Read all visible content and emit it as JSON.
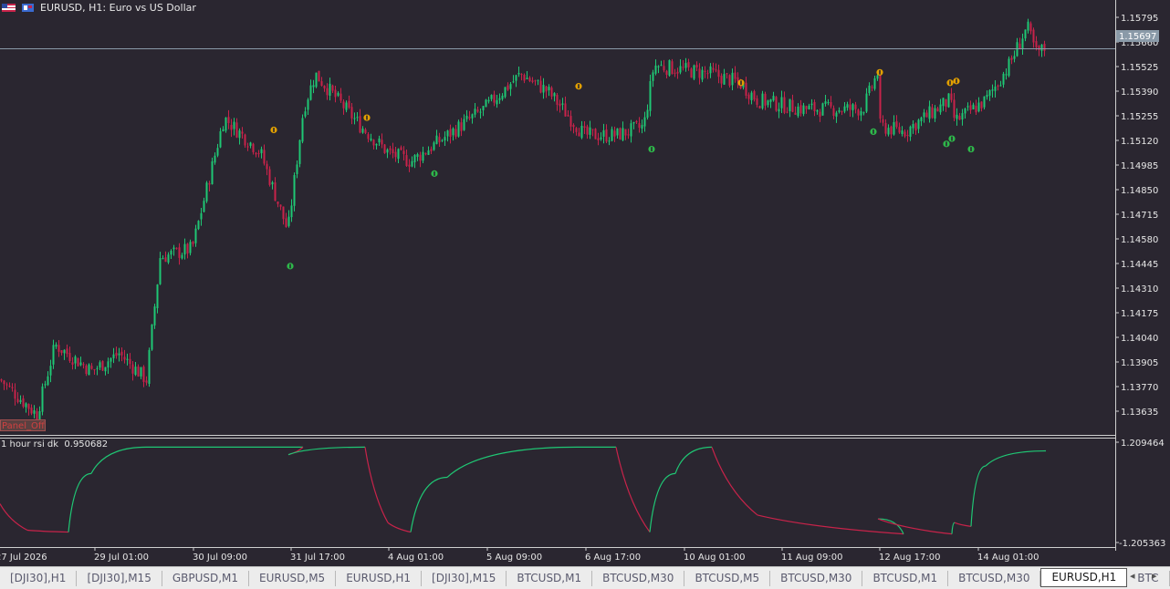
{
  "header": {
    "title": "EURUSD, H1:  Euro vs US Dollar"
  },
  "colors": {
    "background": "#2a2630",
    "bull": "#1fc774",
    "bear": "#c8234a",
    "signal_up": "#e2a000",
    "signal_down": "#2eb84a",
    "grid_line": "#cfcfcf",
    "price_line": "#8a9aa8"
  },
  "price_axis": {
    "labels": [
      "1.15795",
      "1.15660",
      "1.15525",
      "1.15390",
      "1.15255",
      "1.15120",
      "1.14985",
      "1.14850",
      "1.14715",
      "1.14580",
      "1.14445",
      "1.14310",
      "1.14175",
      "1.14040",
      "1.13905",
      "1.13770",
      "1.13635"
    ],
    "current_price": "1.15697"
  },
  "indicator": {
    "label": "1 hour rsi dk",
    "value": "0.950682",
    "axis_top": "1.209464",
    "axis_bottom": "-1.205363"
  },
  "time_axis": {
    "labels": [
      "27 Jul 2026",
      "29 Jul 01:00",
      "30 Jul 09:00",
      "31 Jul 17:00",
      "4 Aug 01:00",
      "5 Aug 09:00",
      "6 Aug 17:00",
      "10 Aug 01:00",
      "11 Aug 09:00",
      "12 Aug 17:00",
      "14 Aug 01:00"
    ]
  },
  "panel_button": {
    "label": "Panel_Off"
  },
  "tabs": [
    {
      "label": "[DJI30],H1",
      "active": false
    },
    {
      "label": "[DJI30],M15",
      "active": false
    },
    {
      "label": "GBPUSD,M1",
      "active": false
    },
    {
      "label": "EURUSD,M5",
      "active": false
    },
    {
      "label": "EURUSD,H1",
      "active": false
    },
    {
      "label": "[DJI30],M15",
      "active": false
    },
    {
      "label": "BTCUSD,M1",
      "active": false
    },
    {
      "label": "BTCUSD,M30",
      "active": false
    },
    {
      "label": "BTCUSD,M5",
      "active": false
    },
    {
      "label": "BTCUSD,M30",
      "active": false
    },
    {
      "label": "BTCUSD,M1",
      "active": false
    },
    {
      "label": "BTCUSD,M30",
      "active": false
    },
    {
      "label": "EURUSD,H1",
      "active": true
    },
    {
      "label": "BTC",
      "active": false
    }
  ],
  "icons": {
    "left_arrow": "◂",
    "right_arrow": "▸",
    "signal_up": "signal-up-icon",
    "signal_down": "signal-down-icon"
  },
  "chart_data": {
    "type": "candlestick",
    "symbol": "EURUSD",
    "timeframe": "H1",
    "ylim": [
      1.1352,
      1.1588
    ],
    "key_points": [
      {
        "x": "27 Jul 2026",
        "y": 1.138
      },
      {
        "x": "28 Jul",
        "y": 1.136
      },
      {
        "x": "28 Jul 12:00",
        "y": 1.14
      },
      {
        "x": "29 Jul 01:00",
        "y": 1.1385
      },
      {
        "x": "29 Jul 12:00",
        "y": 1.1395
      },
      {
        "x": "29 Jul 20:00",
        "y": 1.138
      },
      {
        "x": "30 Jul 01:00",
        "y": 1.145
      },
      {
        "x": "30 Jul 09:00",
        "y": 1.1455
      },
      {
        "x": "30 Jul 20:00",
        "y": 1.153
      },
      {
        "x": "31 Jul 05:00",
        "y": 1.151
      },
      {
        "x": "31 Jul 12:00",
        "y": 1.1465
      },
      {
        "x": "31 Jul 17:00",
        "y": 1.1535
      },
      {
        "x": "3 Aug 01:00",
        "y": 1.1555
      },
      {
        "x": "3 Aug 16:00",
        "y": 1.1525
      },
      {
        "x": "4 Aug 01:00",
        "y": 1.151
      },
      {
        "x": "4 Aug 12:00",
        "y": 1.1505
      },
      {
        "x": "5 Aug 09:00",
        "y": 1.1535
      },
      {
        "x": "5 Aug 20:00",
        "y": 1.1555
      },
      {
        "x": "6 Aug 06:00",
        "y": 1.1545
      },
      {
        "x": "6 Aug 12:00",
        "y": 1.152
      },
      {
        "x": "6 Aug 17:00",
        "y": 1.152
      },
      {
        "x": "7 Aug 01:00",
        "y": 1.1525
      },
      {
        "x": "7 Aug 05:00",
        "y": 1.156
      },
      {
        "x": "10 Aug 01:00",
        "y": 1.1555
      },
      {
        "x": "10 Aug 10:00",
        "y": 1.155
      },
      {
        "x": "11 Aug 01:00",
        "y": 1.154
      },
      {
        "x": "11 Aug 09:00",
        "y": 1.1535
      },
      {
        "x": "12 Aug 01:00",
        "y": 1.1535
      },
      {
        "x": "12 Aug 03:00",
        "y": 1.1557
      },
      {
        "x": "12 Aug 08:00",
        "y": 1.1525
      },
      {
        "x": "12 Aug 17:00",
        "y": 1.1522
      },
      {
        "x": "13 Aug 05:00",
        "y": 1.154
      },
      {
        "x": "13 Aug 10:00",
        "y": 1.1528
      },
      {
        "x": "14 Aug 01:00",
        "y": 1.154
      },
      {
        "x": "14 Aug 06:00",
        "y": 1.156
      },
      {
        "x": "14 Aug 10:00",
        "y": 1.1582
      },
      {
        "x": "14 Aug 13:00",
        "y": 1.1567
      },
      {
        "x": "14 Aug 16:00",
        "y": 1.157
      }
    ],
    "indicator_series": {
      "name": "1 hour rsi dk",
      "ylim": [
        -1.205363,
        1.209464
      ],
      "points": [
        {
          "x": "27 Jul 2026",
          "y": -0.3
        },
        {
          "x": "27 Jul 12:00",
          "y": -1.0
        },
        {
          "x": "28 Jul 16:00",
          "y": -1.05
        },
        {
          "x": "29 Jul 01:00",
          "y": 0.5
        },
        {
          "x": "29 Jul 20:00",
          "y": 1.2
        },
        {
          "x": "31 Jul 17:00",
          "y": 1.2
        },
        {
          "x": "31 Jul 18:00",
          "y": 1.0
        },
        {
          "x": "3 Aug 08:00",
          "y": 1.2
        },
        {
          "x": "4 Aug 01:00",
          "y": -0.8
        },
        {
          "x": "4 Aug 12:00",
          "y": -1.05
        },
        {
          "x": "5 Aug 01:00",
          "y": 0.4
        },
        {
          "x": "6 Aug 01:00",
          "y": 1.2
        },
        {
          "x": "6 Aug 17:00",
          "y": 1.2
        },
        {
          "x": "6 Aug 23:00",
          "y": -1.05
        },
        {
          "x": "7 Aug 08:00",
          "y": 0.5
        },
        {
          "x": "10 Aug 01:00",
          "y": 1.2
        },
        {
          "x": "11 Aug 01:00",
          "y": -0.6
        },
        {
          "x": "12 Aug 17:00",
          "y": -1.1
        },
        {
          "x": "12 Aug 18:00",
          "y": -0.7
        },
        {
          "x": "13 Aug 08:00",
          "y": -1.1
        },
        {
          "x": "13 Aug 10:00",
          "y": -0.8
        },
        {
          "x": "13 Aug 15:00",
          "y": -0.9
        },
        {
          "x": "14 Aug 01:00",
          "y": 0.7
        },
        {
          "x": "14 Aug 16:00",
          "y": 1.1
        }
      ]
    },
    "signals": [
      {
        "type": "up",
        "x": "31 Jul 06:00",
        "y": 1.1523
      },
      {
        "type": "down",
        "x": "31 Jul 08:00",
        "y": 1.1445
      },
      {
        "type": "up",
        "x": "3 Aug 14:00",
        "y": 1.153
      },
      {
        "type": "down",
        "x": "4 Aug 14:00",
        "y": 1.1498
      },
      {
        "type": "up",
        "x": "5 Aug 22:00",
        "y": 1.1548
      },
      {
        "type": "down",
        "x": "7 Aug 02:00",
        "y": 1.1512
      },
      {
        "type": "up",
        "x": "10 Aug 04:00",
        "y": 1.155
      },
      {
        "type": "down",
        "x": "12 Aug 06:00",
        "y": 1.1522
      },
      {
        "type": "up",
        "x": "12 Aug 08:00",
        "y": 1.1556
      },
      {
        "type": "down",
        "x": "13 Aug 06:00",
        "y": 1.1515
      },
      {
        "type": "up",
        "x": "13 Aug 07:00",
        "y": 1.155
      },
      {
        "type": "down",
        "x": "13 Aug 08:00",
        "y": 1.1518
      },
      {
        "type": "up",
        "x": "13 Aug 09:00",
        "y": 1.1551
      },
      {
        "type": "down",
        "x": "13 Aug 15:00",
        "y": 1.1512
      }
    ]
  }
}
